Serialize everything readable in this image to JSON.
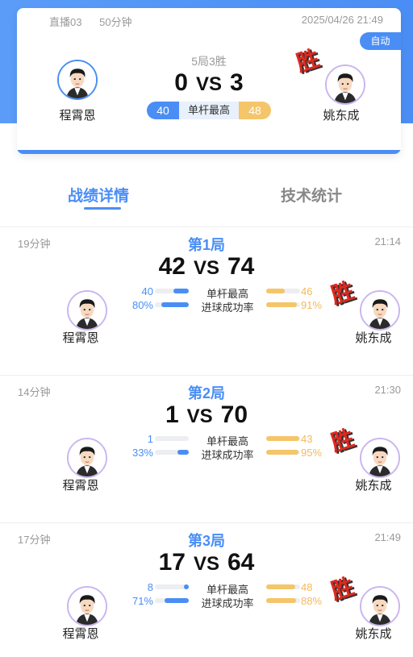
{
  "header": {
    "room": "直播03",
    "duration": "50分钟",
    "datetime": "2025/04/26 21:49",
    "auto_label": "自动",
    "rounds_summary": "5局3胜",
    "left_score": "0",
    "vs": "VS",
    "right_score": "3",
    "win_label": "胜",
    "left_player": "程霄恩",
    "right_player": "姚东成",
    "highest_break_label": "单杆最高",
    "left_highest_break": "40",
    "right_highest_break": "48"
  },
  "tabs": [
    {
      "label": "战绩详情",
      "active": true
    },
    {
      "label": "技术统计",
      "active": false
    }
  ],
  "stat_labels": {
    "highest_break": "单杆最高",
    "pot_success": "进球成功率"
  },
  "rounds": [
    {
      "duration": "19分钟",
      "title": "第1局",
      "time": "21:14",
      "left_score": "42",
      "right_score": "74",
      "vs": "VS",
      "left_player": "程霄恩",
      "right_player": "姚东成",
      "win_label": "胜",
      "left_highest": "40",
      "right_highest": "46",
      "left_highest_ratio": 0.46,
      "right_highest_ratio": 0.54,
      "left_pot": "80%",
      "right_pot": "91%",
      "left_pot_ratio": 0.8,
      "right_pot_ratio": 0.91
    },
    {
      "duration": "14分钟",
      "title": "第2局",
      "time": "21:30",
      "left_score": "1",
      "right_score": "70",
      "vs": "VS",
      "left_player": "程霄恩",
      "right_player": "姚东成",
      "win_label": "胜",
      "left_highest": "1",
      "right_highest": "43",
      "left_highest_ratio": 0.0,
      "right_highest_ratio": 0.98,
      "left_pot": "33%",
      "right_pot": "95%",
      "left_pot_ratio": 0.33,
      "right_pot_ratio": 0.95
    },
    {
      "duration": "17分钟",
      "title": "第3局",
      "time": "21:49",
      "left_score": "17",
      "right_score": "64",
      "vs": "VS",
      "left_player": "程霄恩",
      "right_player": "姚东成",
      "win_label": "胜",
      "left_highest": "8",
      "right_highest": "48",
      "left_highest_ratio": 0.14,
      "right_highest_ratio": 0.86,
      "left_pot": "71%",
      "right_pot": "88%",
      "left_pot_ratio": 0.71,
      "right_pot_ratio": 0.88
    }
  ],
  "colors": {
    "accent": "#4a8ef5",
    "gold": "#f5c56a",
    "win": "#e0281e"
  }
}
